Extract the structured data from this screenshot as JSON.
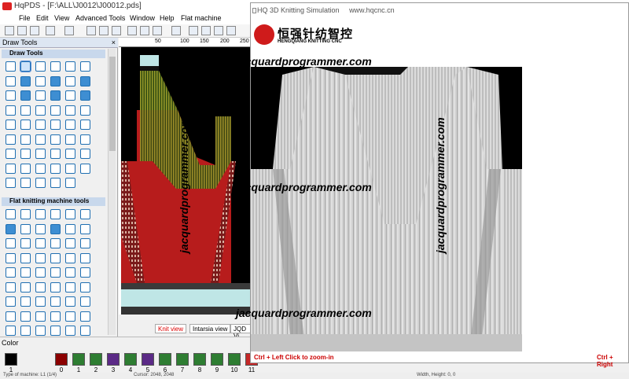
{
  "app": {
    "title": "HqPDS - [F:\\ALL\\J0012\\J00012.pds]",
    "menu": [
      "File",
      "Edit",
      "View",
      "Advanced Tools",
      "Window",
      "Help",
      "Flat machine"
    ]
  },
  "sidebar": {
    "title": "Draw Tools",
    "close": "×",
    "section_draw": "Draw Tools",
    "section_flat": "Flat knitting machine tools"
  },
  "ruler": {
    "ticks": [
      "50",
      "100",
      "150",
      "200",
      "250"
    ]
  },
  "tabs": [
    "Knit view",
    "Intarsia view",
    "JQD Vi"
  ],
  "colors": {
    "label": "Color",
    "numbers": [
      "1",
      "0",
      "1",
      "2",
      "3",
      "4",
      "5",
      "6",
      "7",
      "8",
      "9",
      "10",
      "11"
    ],
    "swatches": [
      "#000000",
      "#8b0000",
      "#2e7d32",
      "#2e7d32",
      "#5b2a86",
      "#2e7d32",
      "#5b2a86",
      "#2e7d32",
      "#2e7d32",
      "#2e7d32",
      "#2e7d32",
      "#2e7d32",
      "#c62828"
    ]
  },
  "status": {
    "left": "Type of machine: L1 (1/4)",
    "middle": "Cursor: 2048, 2048",
    "right": "Width, Height: 0, 0"
  },
  "sim": {
    "title": "HQ 3D Knitting Simulation",
    "url": "www.hqcnc.cn",
    "logo_cn": "恒强针纺智控",
    "logo_en": "HENGQIANG KNITTING CNC",
    "hint_left": "Ctrl + Left Click to zoom-in",
    "hint_right": "Ctrl + Right"
  },
  "watermark": "jacquardprogrammer.com"
}
